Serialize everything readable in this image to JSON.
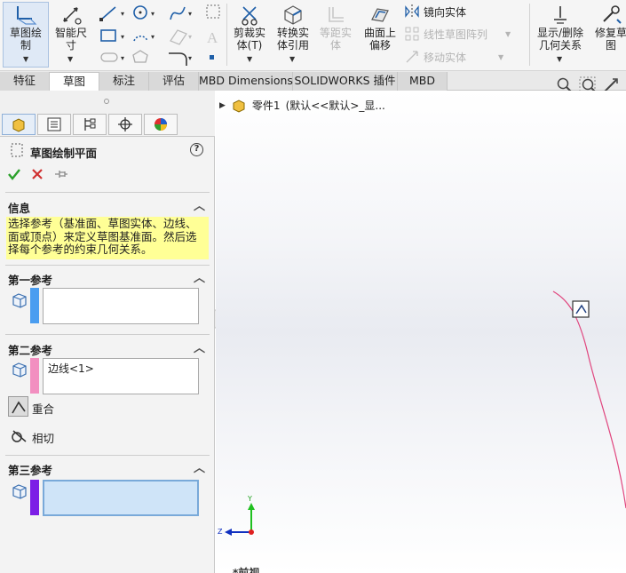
{
  "ribbon": {
    "sketch_label": "草图绘\n制",
    "smart_dim_label": "智能尺\n寸",
    "trim_label": "剪裁实\n体(T)",
    "convert_label": "转换实\n体引用",
    "offset_label": "等距实\n体",
    "surface_offset_label": "曲面上\n偏移",
    "mirror_label": "镜向实体",
    "linear_pattern_label": "线性草图阵列",
    "move_label": "移动实体",
    "display_relations_label": "显示/删除\n几何关系",
    "repair_label": "修复草\n图"
  },
  "tabs": [
    {
      "label": "特征"
    },
    {
      "label": "草图"
    },
    {
      "label": "标注"
    },
    {
      "label": "评估"
    },
    {
      "label": "MBD Dimensions"
    },
    {
      "label": "SOLIDWORKS 插件"
    },
    {
      "label": "MBD"
    }
  ],
  "property_manager": {
    "title": "草图绘制平面",
    "help": "?",
    "info_heading": "信息",
    "info_text": "选择参考（基准面、草图实体、边线、面或顶点）来定义草图基准面。然后选择每个参考的约束几何关系。",
    "first_ref_heading": "第一参考",
    "first_ref_value": "",
    "second_ref_heading": "第二参考",
    "second_ref_value": "边线<1>",
    "coincident_label": "重合",
    "tangent_label": "相切",
    "third_ref_heading": "第三参考",
    "third_ref_value": ""
  },
  "viewport": {
    "part_name": "零件1",
    "config_text": "(默认<<默认>_显...",
    "triad_y": "Y",
    "triad_z": "Z",
    "bottom_label": "*前视"
  },
  "colors": {
    "first_ref_bar": "#4a9df0",
    "second_ref_bar": "#f28fc0",
    "third_ref_bar": "#7c1ee6",
    "info_bg": "#ffff96",
    "edge_curve": "#e0457e"
  }
}
